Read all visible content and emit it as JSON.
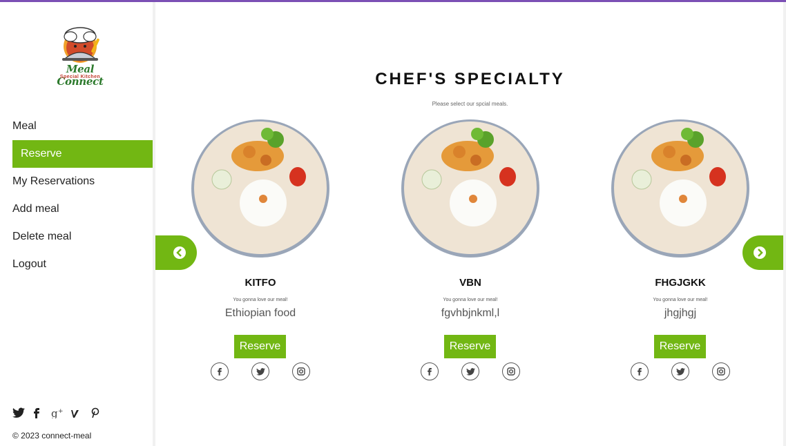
{
  "brand": {
    "title": "Meal Connect",
    "subtitle": "Special Kitchen"
  },
  "nav": {
    "items": [
      {
        "label": "Meal"
      },
      {
        "label": "Reserve"
      },
      {
        "label": "My Reservations"
      },
      {
        "label": "Add meal"
      },
      {
        "label": "Delete meal"
      },
      {
        "label": "Logout"
      }
    ],
    "active": "Reserve"
  },
  "social_icons": [
    "twitter-icon",
    "facebook-icon",
    "google-plus-icon",
    "vimeo-icon",
    "pinterest-icon"
  ],
  "footer": {
    "copyright": "© 2023 connect-meal"
  },
  "main": {
    "heading": "CHEF'S SPECIALTY",
    "subheading": "Please select our spcial meals."
  },
  "cards": [
    {
      "name": "KITFO",
      "tagline": "You gonna love our meal!",
      "description": "Ethiopian food",
      "button": "Reserve"
    },
    {
      "name": "VBN",
      "tagline": "You gonna love our meal!",
      "description": "fgvhbjnkml,l",
      "button": "Reserve"
    },
    {
      "name": "FHGJGKK",
      "tagline": "You gonna love our meal!",
      "description": "jhgjhgj",
      "button": "Reserve"
    }
  ],
  "card_icons": [
    "facebook-icon",
    "twitter-icon",
    "instagram-icon"
  ],
  "colors": {
    "accent": "#72b713",
    "topbar": "#7b4fb5"
  }
}
